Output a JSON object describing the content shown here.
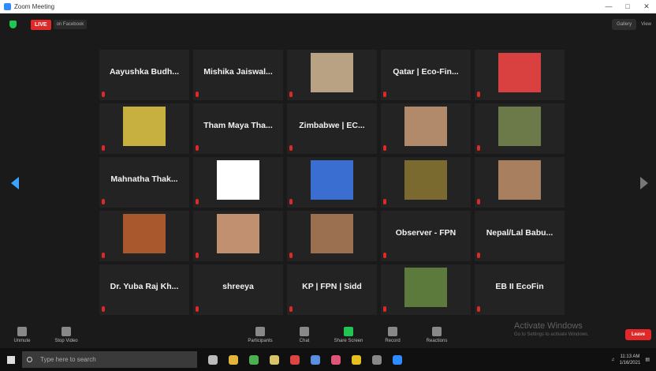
{
  "window": {
    "title": "Zoom Meeting"
  },
  "topbar": {
    "live_label": "LIVE",
    "live_sub": "on Facebook",
    "view_label": "Gallery",
    "fullscreen_label": "View"
  },
  "grid": {
    "tiles": [
      {
        "name": "Aayushka Budh...",
        "label": ""
      },
      {
        "name": "Mishika Jaiswal...",
        "label": ""
      },
      {
        "name": "",
        "label": "",
        "photo": "#b9a284"
      },
      {
        "name": "Qatar | Eco-Fin...",
        "label": ""
      },
      {
        "name": "",
        "label": "",
        "photo": "#d94040"
      },
      {
        "name": "",
        "label": "",
        "photo": "#c8b040"
      },
      {
        "name": "Tham Maya Tha...",
        "label": ""
      },
      {
        "name": "Zimbabwe | EC...",
        "label": ""
      },
      {
        "name": "",
        "label": "",
        "photo": "#b08a6a"
      },
      {
        "name": "",
        "label": "",
        "photo": "#6b7a48"
      },
      {
        "name": "Mahnatha Thak...",
        "label": ""
      },
      {
        "name": "",
        "label": "",
        "photo": "#ffffff"
      },
      {
        "name": "",
        "label": "",
        "photo": "#3a6fd1"
      },
      {
        "name": "",
        "label": "",
        "photo": "#7a6a30"
      },
      {
        "name": "",
        "label": "",
        "photo": "#a88060"
      },
      {
        "name": "",
        "label": "",
        "photo": "#a9582e"
      },
      {
        "name": "",
        "label": "",
        "photo": "#c09070"
      },
      {
        "name": "",
        "label": "",
        "photo": "#9a7050"
      },
      {
        "name": "Observer - FPN",
        "label": ""
      },
      {
        "name": "Nepal/Lal Babu...",
        "label": ""
      },
      {
        "name": "Dr. Yuba Raj Kh...",
        "label": ""
      },
      {
        "name": "shreeya",
        "label": ""
      },
      {
        "name": "KP | FPN | Sidd",
        "label": ""
      },
      {
        "name": "",
        "label": "",
        "photo": "#5c7a3c"
      },
      {
        "name": "EB II EcoFin",
        "label": ""
      }
    ]
  },
  "toolbar": {
    "items": [
      {
        "label": "Unmute",
        "icon": "microphone-icon"
      },
      {
        "label": "Stop Video",
        "icon": "video-icon"
      },
      {
        "label": "Participants",
        "icon": "participants-icon"
      },
      {
        "label": "Chat",
        "icon": "chat-icon"
      },
      {
        "label": "Share Screen",
        "icon": "share-screen-icon"
      },
      {
        "label": "Record",
        "icon": "record-icon"
      },
      {
        "label": "Reactions",
        "icon": "reactions-icon"
      }
    ],
    "end_label": "Leave",
    "watermark_line1": "Activate Windows",
    "watermark_line2": "Go to Settings to activate Windows."
  },
  "taskbar": {
    "search_placeholder": "Type here to search",
    "time": "11:13 AM",
    "date": "1/16/2021"
  },
  "colors": {
    "accent": "#2d8cff",
    "live": "#e02828",
    "share": "#23c552"
  }
}
